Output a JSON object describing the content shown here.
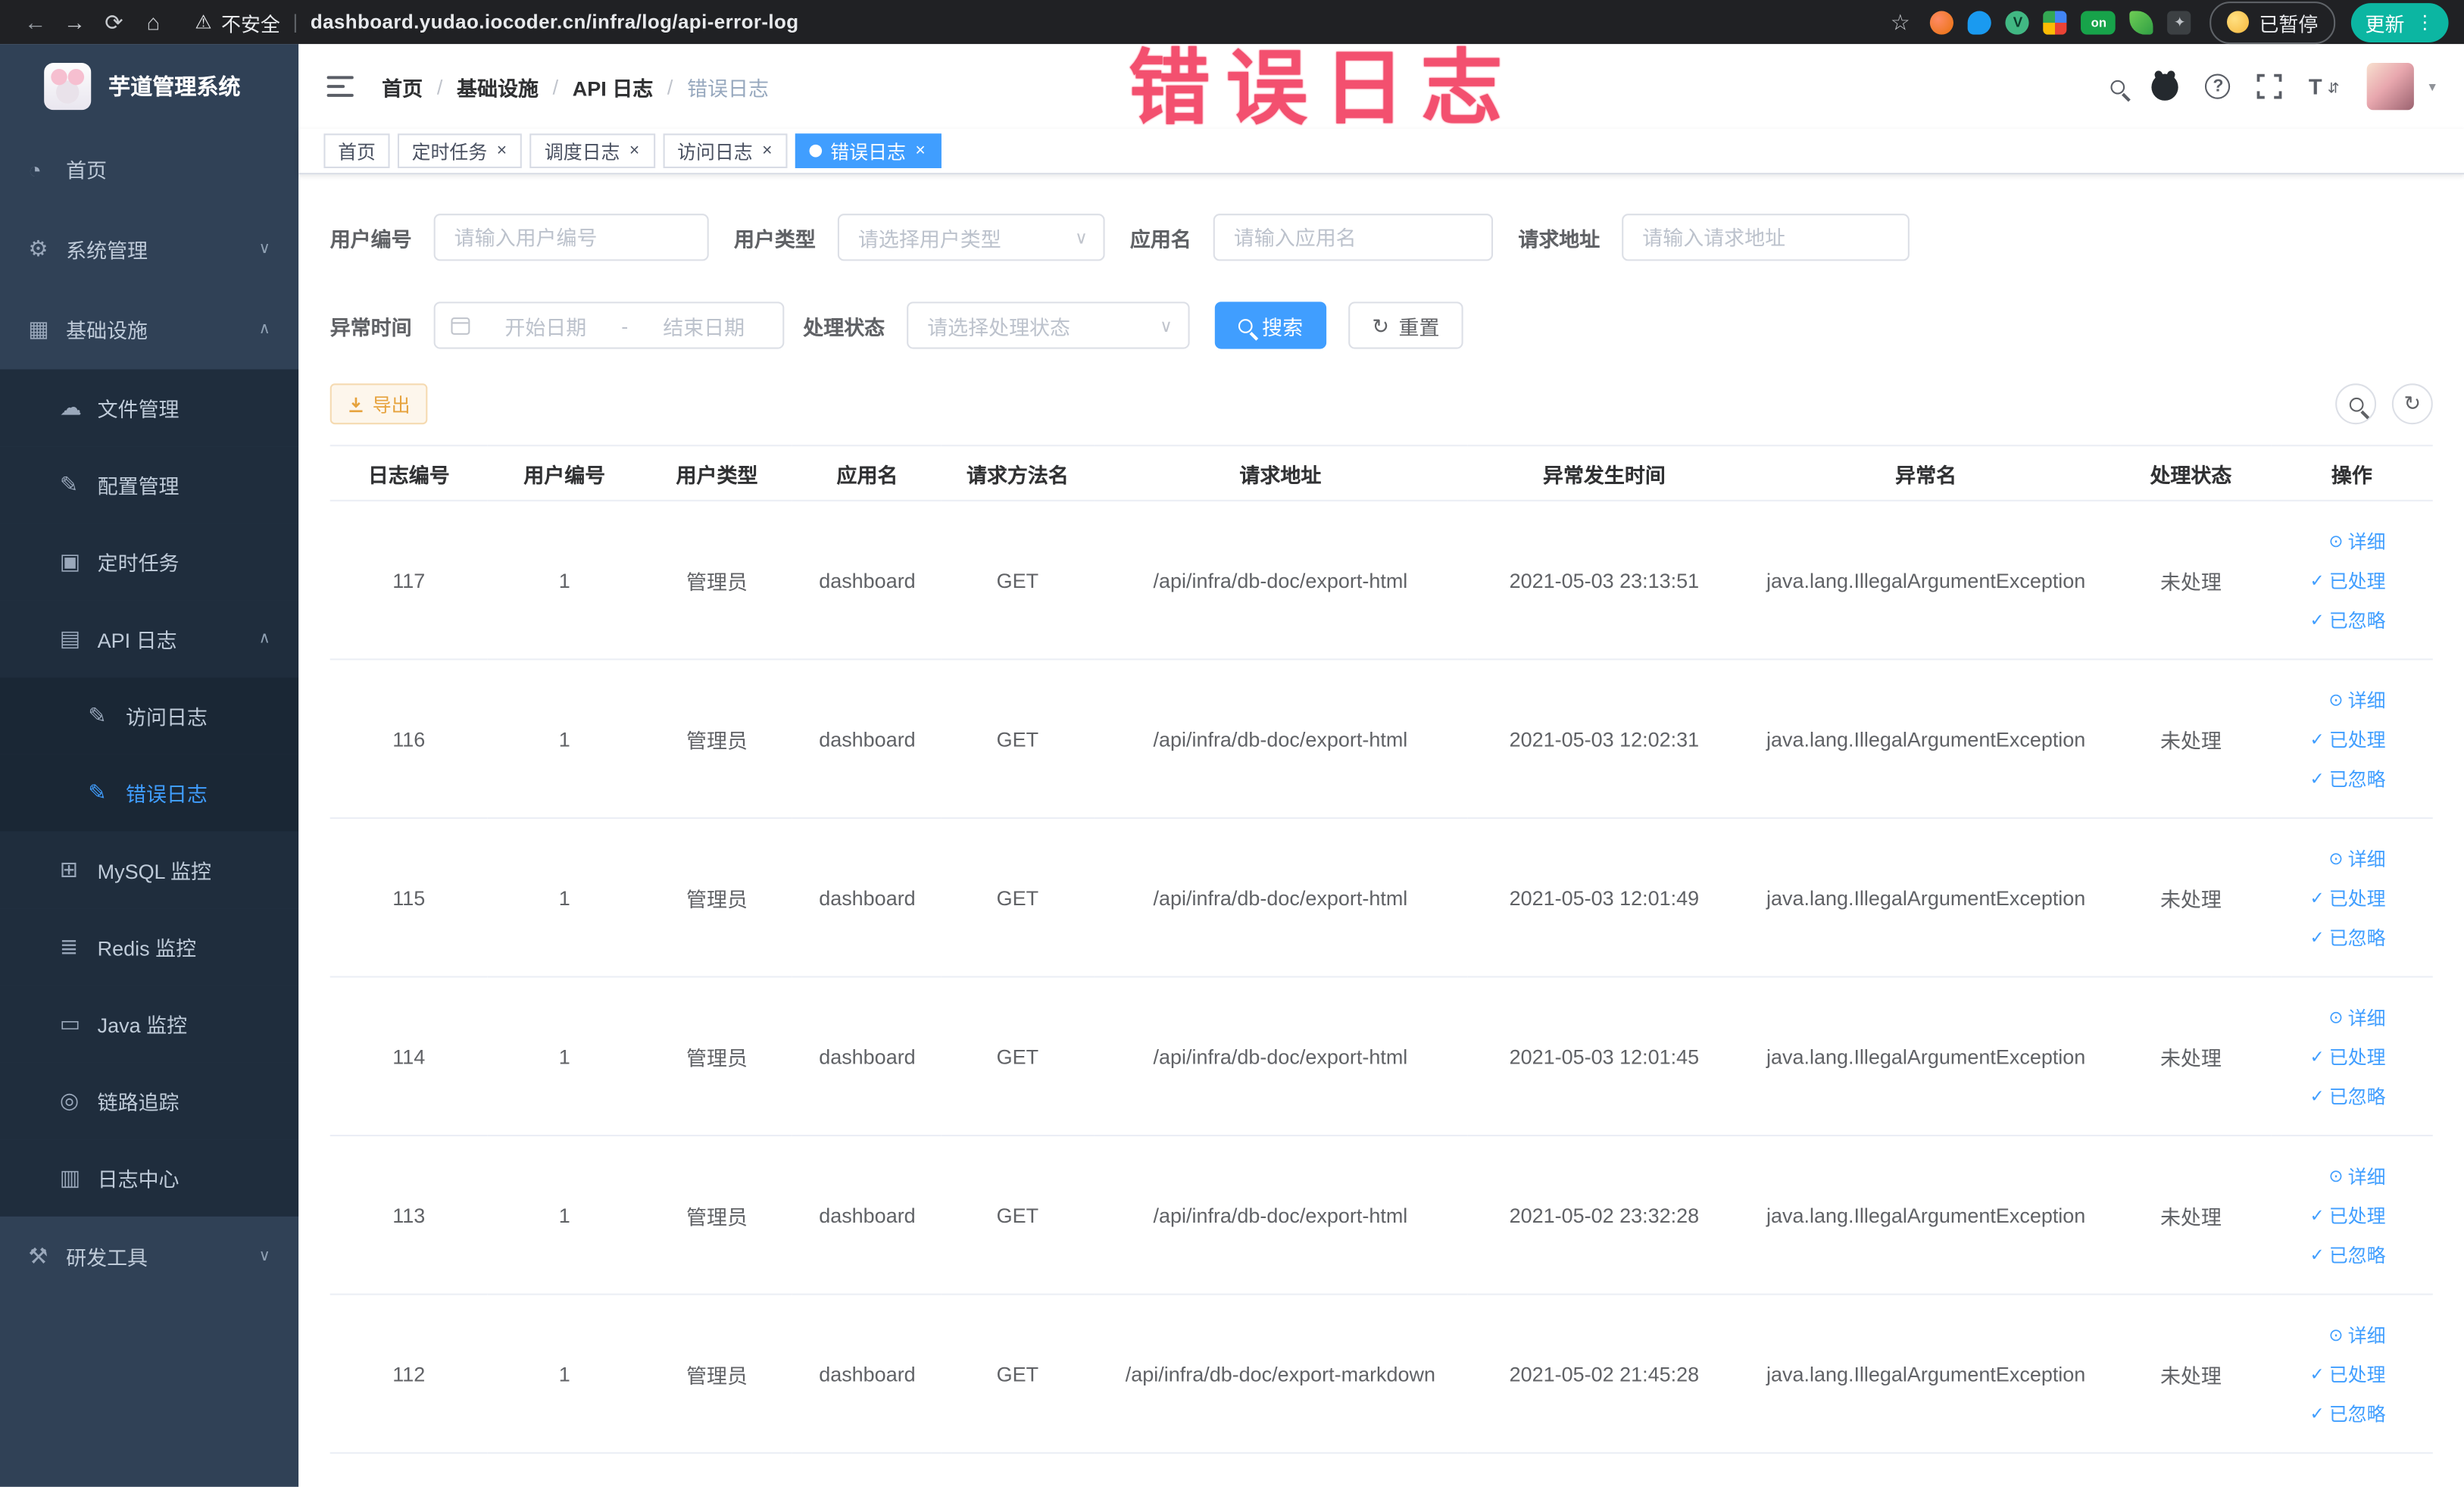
{
  "browser": {
    "security_warning": "不安全",
    "url": "dashboard.yudao.iocoder.cn/infra/log/api-error-log",
    "paused_label": "已暂停",
    "update_label": "更新",
    "extension_on_badge": "on"
  },
  "watermark": "错误日志",
  "sidebar": {
    "logo_title": "芋道管理系统",
    "items": [
      {
        "label": "首页",
        "icon": "gauge-icon"
      },
      {
        "label": "系统管理",
        "icon": "gear-icon",
        "state": "collapsed"
      },
      {
        "label": "基础设施",
        "icon": "grid-icon",
        "state": "expanded"
      },
      {
        "label": "文件管理",
        "icon": "cloud-icon"
      },
      {
        "label": "配置管理",
        "icon": "edit-icon"
      },
      {
        "label": "定时任务",
        "icon": "cube-icon"
      },
      {
        "label": "API 日志",
        "icon": "document-icon",
        "state": "expanded"
      },
      {
        "label": "访问日志",
        "icon": "edit-icon"
      },
      {
        "label": "错误日志",
        "icon": "edit-icon",
        "active": true
      },
      {
        "label": "MySQL 监控",
        "icon": "grid-icon"
      },
      {
        "label": "Redis 监控",
        "icon": "layers-icon"
      },
      {
        "label": "Java 监控",
        "icon": "monitor-icon"
      },
      {
        "label": "链路追踪",
        "icon": "eye-icon"
      },
      {
        "label": "日志中心",
        "icon": "log-icon"
      },
      {
        "label": "研发工具",
        "icon": "tool-icon",
        "state": "collapsed"
      }
    ]
  },
  "navbar": {
    "breadcrumb": [
      "首页",
      "基础设施",
      "API 日志",
      "错误日志"
    ]
  },
  "tabs": [
    {
      "label": "首页"
    },
    {
      "label": "定时任务"
    },
    {
      "label": "调度日志"
    },
    {
      "label": "访问日志"
    },
    {
      "label": "错误日志"
    }
  ],
  "filters": {
    "user_id_label": "用户编号",
    "user_id_placeholder": "请输入用户编号",
    "user_type_label": "用户类型",
    "user_type_placeholder": "请选择用户类型",
    "app_name_label": "应用名",
    "app_name_placeholder": "请输入应用名",
    "request_url_label": "请求地址",
    "request_url_placeholder": "请输入请求地址",
    "exception_time_label": "异常时间",
    "date_start_placeholder": "开始日期",
    "date_separator": "-",
    "date_end_placeholder": "结束日期",
    "process_status_label": "处理状态",
    "process_status_placeholder": "请选择处理状态",
    "search_label": "搜索",
    "reset_label": "重置"
  },
  "toolbar": {
    "export_label": "导出"
  },
  "table": {
    "columns": [
      "日志编号",
      "用户编号",
      "用户类型",
      "应用名",
      "请求方法名",
      "请求地址",
      "异常发生时间",
      "异常名",
      "处理状态",
      "操作"
    ],
    "actions": [
      "详细",
      "已处理",
      "已忽略"
    ],
    "rows": [
      {
        "id": "117",
        "user_id": "1",
        "user_type": "管理员",
        "app": "dashboard",
        "method": "GET",
        "url": "/api/infra/db-doc/export-html",
        "time": "2021-05-03 23:13:51",
        "exception": "java.lang.IllegalArgumentException",
        "status": "未处理"
      },
      {
        "id": "116",
        "user_id": "1",
        "user_type": "管理员",
        "app": "dashboard",
        "method": "GET",
        "url": "/api/infra/db-doc/export-html",
        "time": "2021-05-03 12:02:31",
        "exception": "java.lang.IllegalArgumentException",
        "status": "未处理"
      },
      {
        "id": "115",
        "user_id": "1",
        "user_type": "管理员",
        "app": "dashboard",
        "method": "GET",
        "url": "/api/infra/db-doc/export-html",
        "time": "2021-05-03 12:01:49",
        "exception": "java.lang.IllegalArgumentException",
        "status": "未处理"
      },
      {
        "id": "114",
        "user_id": "1",
        "user_type": "管理员",
        "app": "dashboard",
        "method": "GET",
        "url": "/api/infra/db-doc/export-html",
        "time": "2021-05-03 12:01:45",
        "exception": "java.lang.IllegalArgumentException",
        "status": "未处理"
      },
      {
        "id": "113",
        "user_id": "1",
        "user_type": "管理员",
        "app": "dashboard",
        "method": "GET",
        "url": "/api/infra/db-doc/export-html",
        "time": "2021-05-02 23:32:28",
        "exception": "java.lang.IllegalArgumentException",
        "status": "未处理"
      },
      {
        "id": "112",
        "user_id": "1",
        "user_type": "管理员",
        "app": "dashboard",
        "method": "GET",
        "url": "/api/infra/db-doc/export-markdown",
        "time": "2021-05-02 21:45:28",
        "exception": "java.lang.IllegalArgumentException",
        "status": "未处理"
      }
    ]
  }
}
